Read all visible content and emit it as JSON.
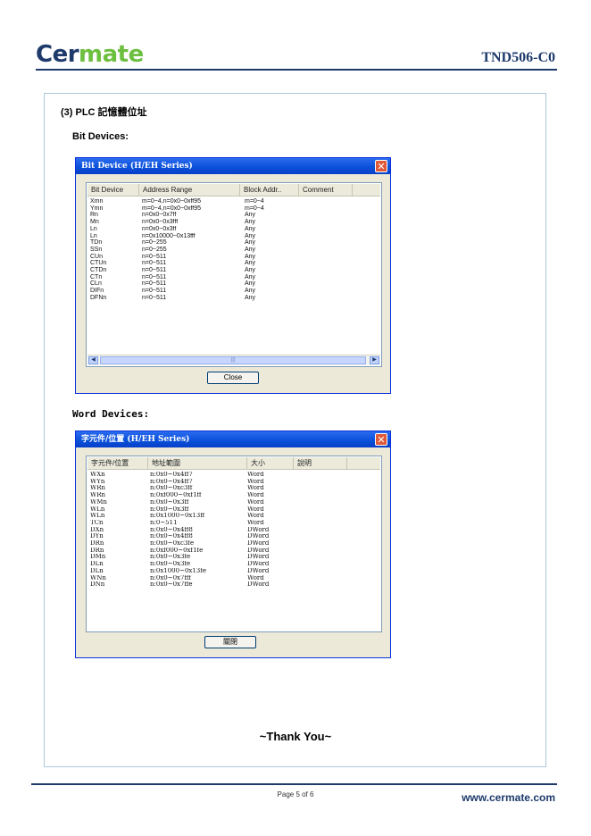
{
  "header": {
    "logo_part1": "Cer",
    "logo_part2": "mate",
    "doc_id": "TND506-C0"
  },
  "section_title": "(3) PLC 記憶體位址",
  "bit_devices": {
    "heading": "Bit Devices:",
    "dialog_title": "Bit Device (H/EH Series)",
    "columns": [
      "Bit Device",
      "Address Range",
      "Block Addr..",
      "Comment"
    ],
    "rows": [
      [
        "Xmn",
        "m=0~4,n=0x0~0xff95",
        "m=0~4"
      ],
      [
        "Ymn",
        "m=0~4,n=0x0~0xff95",
        "m=0~4"
      ],
      [
        "Rn",
        "n=0x0~0x7ff",
        "Any"
      ],
      [
        "Mn",
        "n=0x0~0x3fff",
        "Any"
      ],
      [
        "Ln",
        "n=0x0~0x3ff",
        "Any"
      ],
      [
        "Ln",
        "n=0x10000~0x13fff",
        "Any"
      ],
      [
        "TDn",
        "n=0~255",
        "Any"
      ],
      [
        "SSn",
        "n=0~255",
        "Any"
      ],
      [
        "CUn",
        "n=0~511",
        "Any"
      ],
      [
        "CTUn",
        "n=0~511",
        "Any"
      ],
      [
        "CTDn",
        "n=0~511",
        "Any"
      ],
      [
        "CTn",
        "n=0~511",
        "Any"
      ],
      [
        "CLn",
        "n=0~511",
        "Any"
      ],
      [
        "DIFn",
        "n=0~511",
        "Any"
      ],
      [
        "DFNn",
        "n=0~511",
        "Any"
      ]
    ],
    "close_label": "Close"
  },
  "word_devices": {
    "heading": "Word Devices:",
    "dialog_title": "字元件/位置 (H/EH Series)",
    "columns": [
      "字元件/位置",
      "地址範圍",
      "大小",
      "說明"
    ],
    "rows": [
      [
        "WXn",
        "n:0x0~0x4ff7",
        "Word"
      ],
      [
        "WYn",
        "n:0x0~0x4ff7",
        "Word"
      ],
      [
        "WRn",
        "n:0x0~0xc3ff",
        "Word"
      ],
      [
        "WRn",
        "n:0xf000~0xf1ff",
        "Word"
      ],
      [
        "WMn",
        "n:0x0~0x3ff",
        "Word"
      ],
      [
        "WLn",
        "n:0x0~0x3ff",
        "Word"
      ],
      [
        "WLn",
        "n:0x1000~0x13ff",
        "Word"
      ],
      [
        "TCn",
        "n:0~511",
        "Word"
      ],
      [
        "DXn",
        "n:0x0~0x4ff8",
        "DWord"
      ],
      [
        "DYn",
        "n:0x0~0x4ff8",
        "DWord"
      ],
      [
        "DRn",
        "n:0x0~0xc3fe",
        "DWord"
      ],
      [
        "DRn",
        "n:0xf000~0xf1fe",
        "DWord"
      ],
      [
        "DMn",
        "n:0x0~0x3fe",
        "DWord"
      ],
      [
        "DLn",
        "n:0x0~0x3fe",
        "DWord"
      ],
      [
        "DLn",
        "n:0x1000~0x13fe",
        "DWord"
      ],
      [
        "WNn",
        "n:0x0~0x7fff",
        "Word"
      ],
      [
        "DNn",
        "n:0x0~0x7ffe",
        "DWord"
      ]
    ],
    "close_label": "關閉"
  },
  "thanks": "~Thank You~",
  "footer": {
    "page": "Page 5 of 6",
    "website": "www.cermate.com"
  },
  "colors": {
    "brand_blue": "#1d3a6b",
    "brand_green": "#6cbf3f",
    "titlebar_blue": "#0a4fd8"
  }
}
